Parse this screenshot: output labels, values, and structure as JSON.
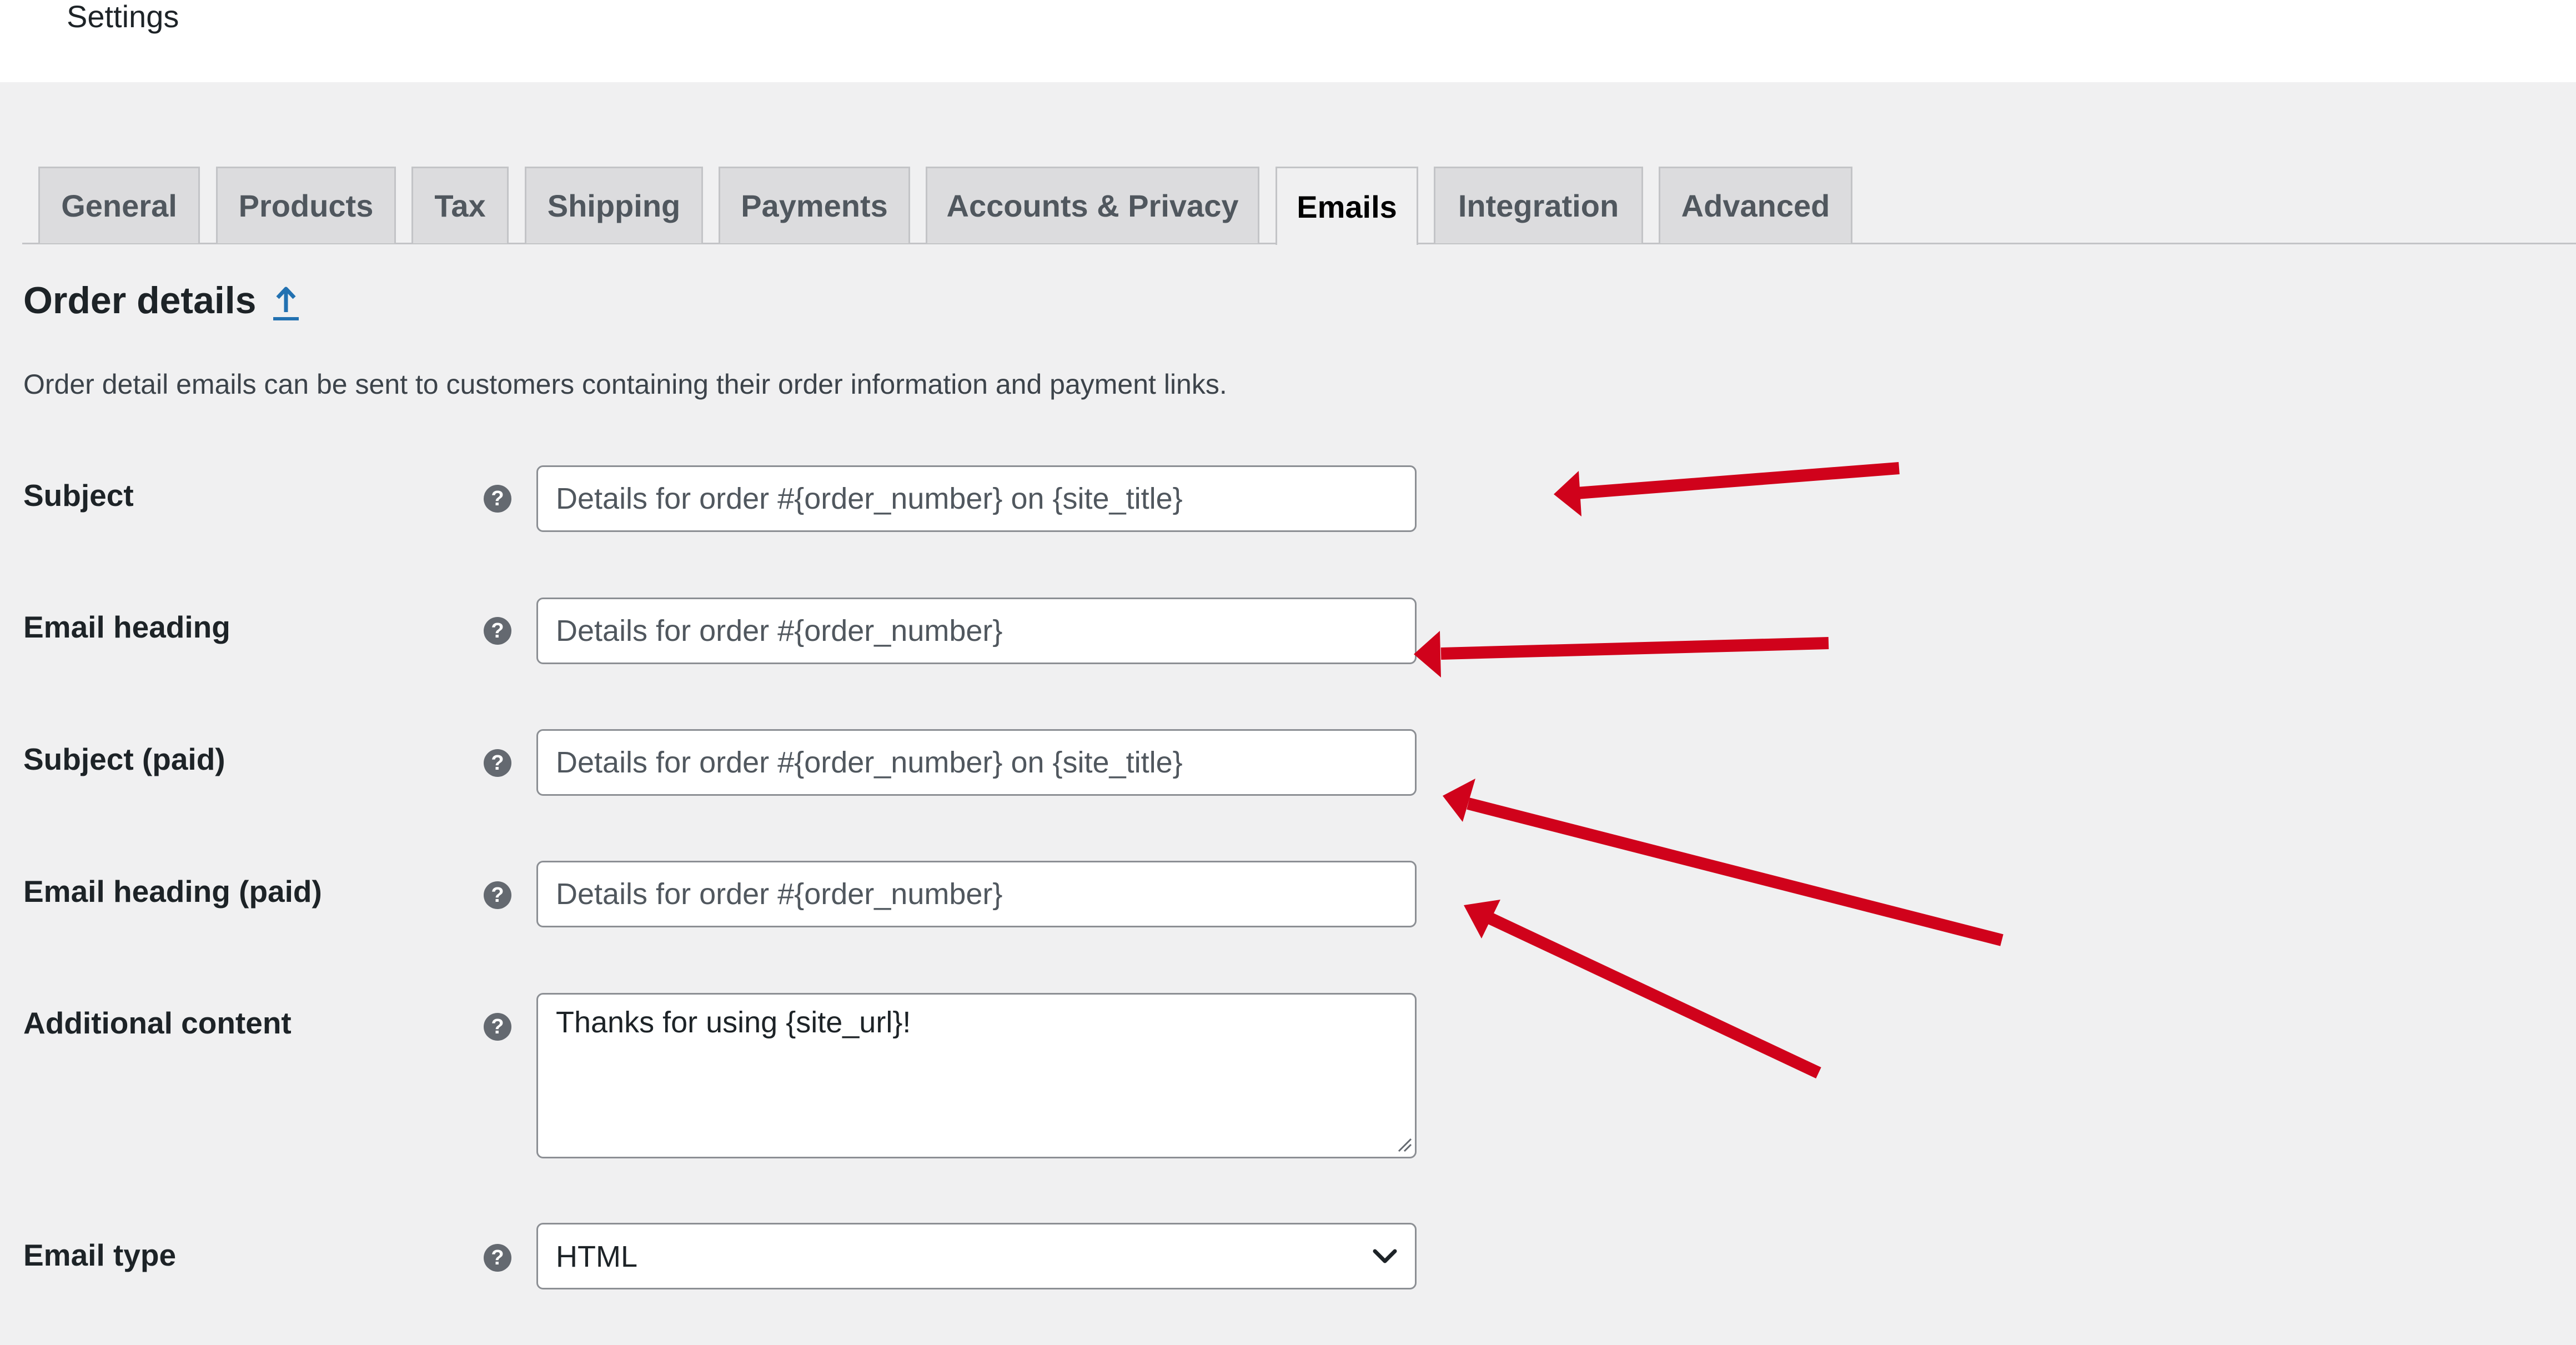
{
  "header": {
    "title": "Settings"
  },
  "tabs": [
    {
      "label": "General"
    },
    {
      "label": "Products"
    },
    {
      "label": "Tax"
    },
    {
      "label": "Shipping"
    },
    {
      "label": "Payments"
    },
    {
      "label": "Accounts & Privacy"
    },
    {
      "label": "Emails",
      "active": true
    },
    {
      "label": "Integration"
    },
    {
      "label": "Advanced"
    }
  ],
  "section": {
    "title": "Order details",
    "up_icon": "up-arrow-icon",
    "description": "Order detail emails can be sent to customers containing their order information and payment links."
  },
  "fields": {
    "subject": {
      "label": "Subject",
      "placeholder": "Details for order #{order_number} on {site_title}"
    },
    "email_heading": {
      "label": "Email heading",
      "placeholder": "Details for order #{order_number}"
    },
    "subject_paid": {
      "label": "Subject (paid)",
      "placeholder": "Details for order #{order_number} on {site_title}"
    },
    "email_heading_paid": {
      "label": "Email heading (paid)",
      "placeholder": "Details for order #{order_number}"
    },
    "additional_content": {
      "label": "Additional content",
      "value": "Thanks for using {site_url}!"
    },
    "email_type": {
      "label": "Email type",
      "value": "HTML"
    }
  },
  "icons": {
    "help": "help-question-icon",
    "select": "chevron-down-icon"
  },
  "colors": {
    "annotation_arrow": "#d0021b",
    "link": "#2271b1",
    "background": "#f0f0f1"
  }
}
